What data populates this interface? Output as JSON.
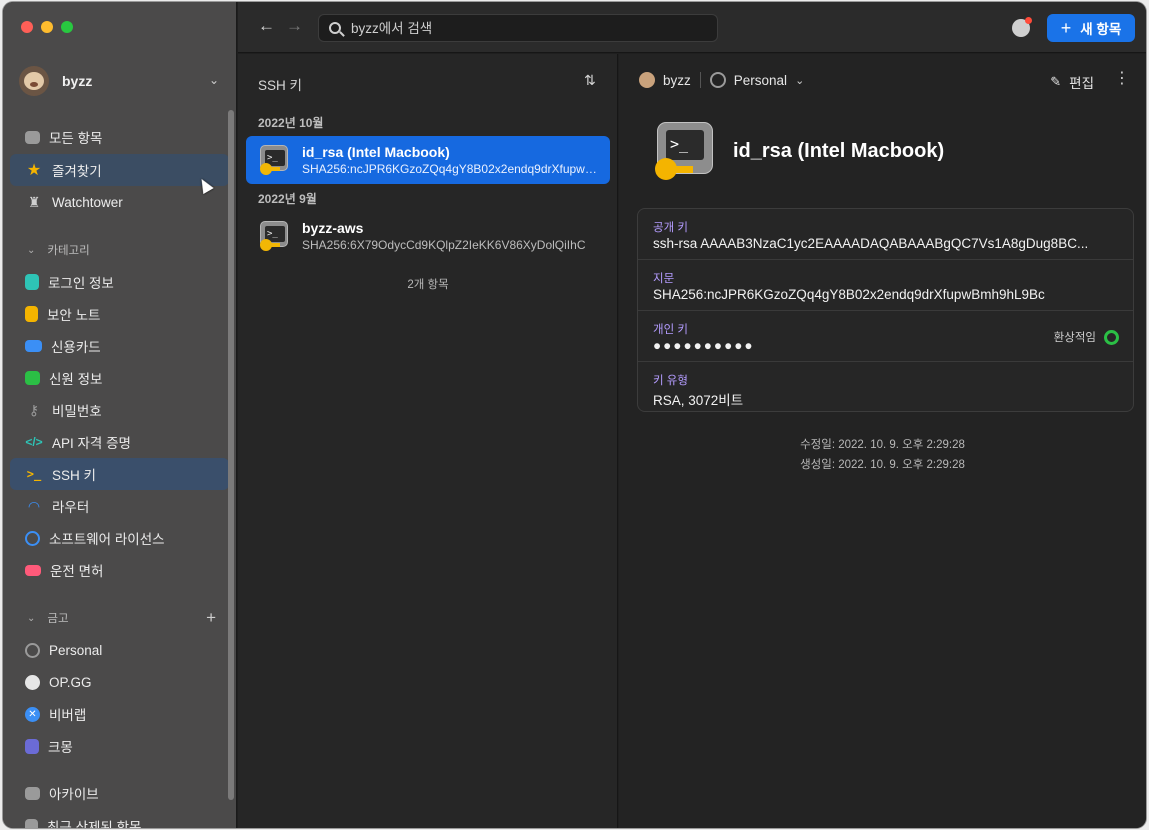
{
  "account": {
    "name": "byzz"
  },
  "sidebar": {
    "top_items": [
      {
        "label": "모든 항목",
        "icon": "inbox-icon"
      },
      {
        "label": "즐겨찾기",
        "icon": "star-icon"
      },
      {
        "label": "Watchtower",
        "icon": "watchtower-icon"
      }
    ],
    "categories_header": "카테고리",
    "categories": [
      {
        "label": "로그인 정보",
        "icon": "key-icon",
        "color": "#2ec4b6"
      },
      {
        "label": "보안 노트",
        "icon": "note-icon",
        "color": "#f4b400"
      },
      {
        "label": "신용카드",
        "icon": "credit-card-icon",
        "color": "#3b8ff5"
      },
      {
        "label": "신원 정보",
        "icon": "identity-icon",
        "color": "#2bbf45"
      },
      {
        "label": "비밀번호",
        "icon": "password-icon",
        "color": "#9a9a9a"
      },
      {
        "label": "API 자격 증명",
        "icon": "code-icon",
        "color": "#2ec4b6"
      },
      {
        "label": "SSH 키",
        "icon": "terminal-icon",
        "color": "#f4b400"
      },
      {
        "label": "라우터",
        "icon": "wifi-icon",
        "color": "#3b8ff5"
      },
      {
        "label": "소프트웨어 라이선스",
        "icon": "license-icon",
        "color": "#3b8ff5"
      },
      {
        "label": "운전 면허",
        "icon": "car-icon",
        "color": "#ff5a7a"
      }
    ],
    "vaults_header": "금고",
    "vaults": [
      {
        "label": "Personal",
        "icon": "vault-icon"
      },
      {
        "label": "OP.GG",
        "icon": "opgg-icon"
      },
      {
        "label": "비버랩",
        "icon": "tools-icon"
      },
      {
        "label": "크몽",
        "icon": "kmong-icon"
      }
    ],
    "bottom_items": [
      {
        "label": "아카이브",
        "icon": "archive-icon"
      },
      {
        "label": "최근 삭제된 항목",
        "icon": "trash-icon"
      }
    ]
  },
  "toolbar": {
    "search_placeholder": "byzz에서 검색",
    "new_item_label": "새 항목"
  },
  "list": {
    "title": "SSH 키",
    "groups": [
      {
        "header": "2022년 10월",
        "items": [
          {
            "title": "id_rsa (Intel Macbook)",
            "subtitle": "SHA256:ncJPR6KGzoZQq4gY8B02x2endq9drXfupwBmh9hL9Bc"
          }
        ]
      },
      {
        "header": "2022년 9월",
        "items": [
          {
            "title": "byzz-aws",
            "subtitle": "SHA256:6X79OdycCd9KQlpZ2IeKK6V86XyDolQiIhC"
          }
        ]
      }
    ],
    "count": "2개 항목"
  },
  "detail": {
    "account": "byzz",
    "vault": "Personal",
    "edit_label": "편집",
    "title": "id_rsa (Intel Macbook)",
    "fields": [
      {
        "label": "공개 키",
        "value": "ssh-rsa AAAAB3NzaC1yc2EAAAADAQABAAABgQC7Vs1A8gDug8BC..."
      },
      {
        "label": "지문",
        "value": "SHA256:ncJPR6KGzoZQq4gY8B02x2endq9drXfupwBmh9hL9Bc"
      },
      {
        "label": "개인 키",
        "value": "●●●●●●●●●●",
        "strength": "환상적임"
      },
      {
        "label": "키 유형",
        "value": "RSA, 3072비트"
      }
    ],
    "modified": "수정일: 2022. 10. 9. 오후 2:29:28",
    "created": "생성일: 2022. 10. 9. 오후 2:29:28"
  }
}
